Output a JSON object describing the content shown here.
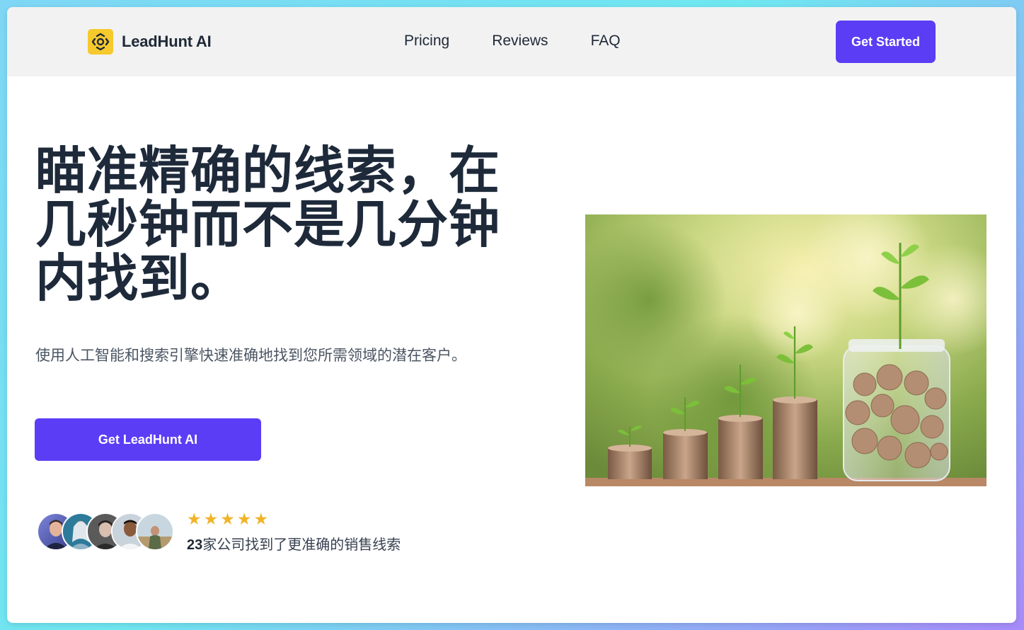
{
  "navbar": {
    "brand_name": "LeadHunt AI",
    "logo_icon": "scan-target-icon",
    "links": [
      "Pricing",
      "Reviews",
      "FAQ"
    ],
    "cta_label": "Get Started"
  },
  "hero": {
    "headline_lines": [
      "瞄准精确的线索，在",
      "几秒钟而不是几分钟",
      "内找到。"
    ],
    "subtext": "使用人工智能和搜索引擎快速准确地找到您所需领域的潜在客户。",
    "cta_label": "Get LeadHunt AI",
    "image": "coin-stacks-with-plants-and-jar"
  },
  "social_proof": {
    "avatar_count": 5,
    "rating": 5,
    "count_text": "23",
    "caption_text": "家公司找到了更准确的销售线索"
  },
  "colors": {
    "accent": "#5b3df5",
    "star": "#f0b429",
    "logo": "#f6c92d",
    "heading": "#1e2a3a",
    "navbar_bg": "#f2f2f3"
  }
}
